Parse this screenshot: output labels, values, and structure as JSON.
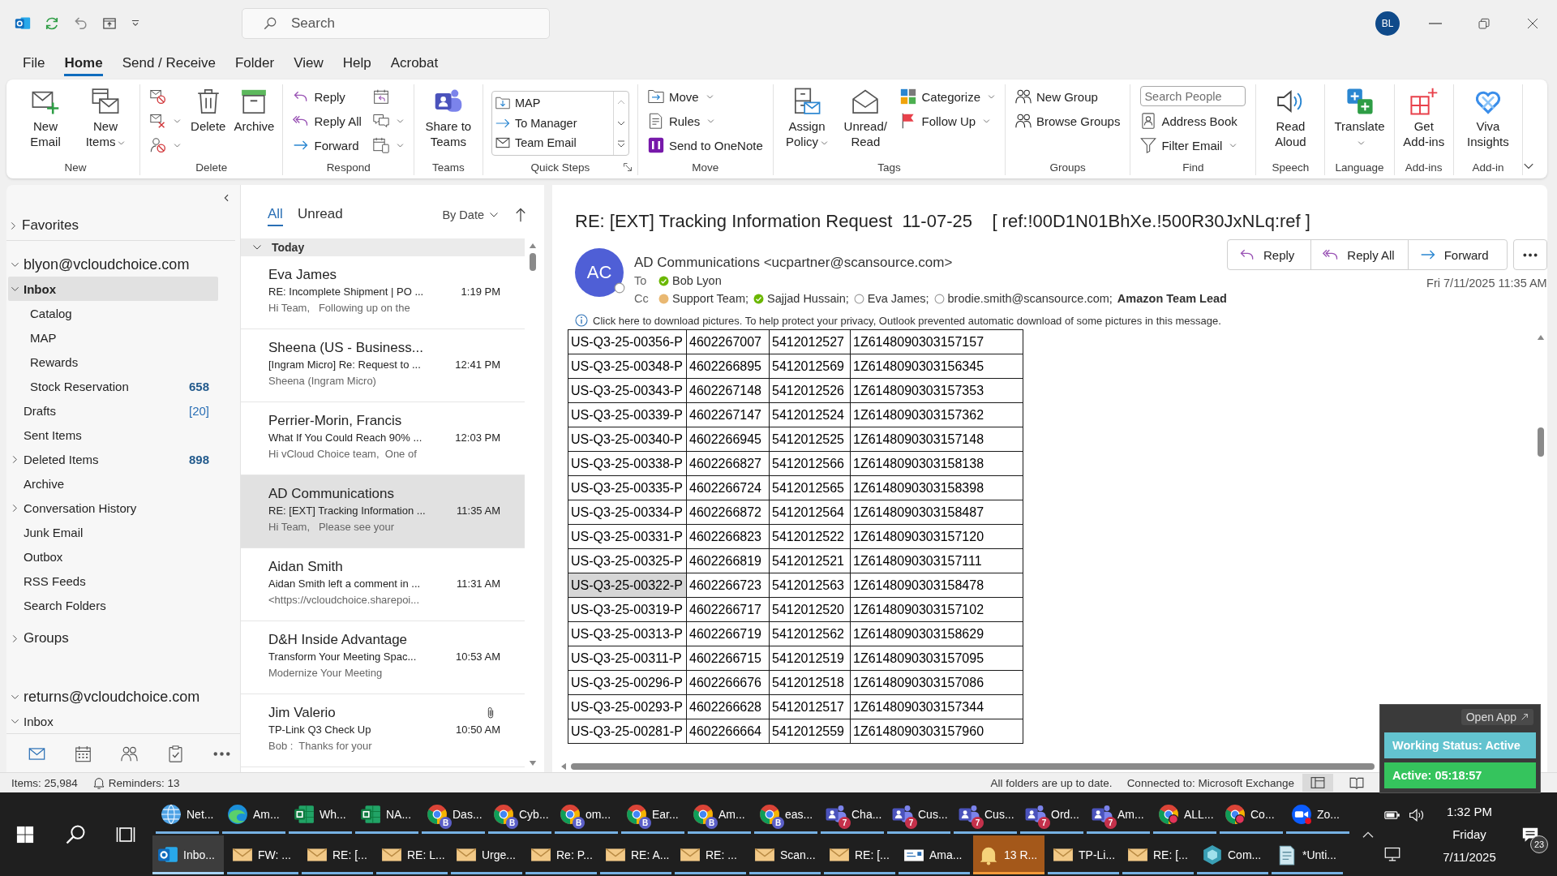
{
  "window": {
    "search_placeholder": "Search",
    "account_initials": "BL"
  },
  "menu_tabs": [
    {
      "label": "File",
      "selected": false
    },
    {
      "label": "Home",
      "selected": true
    },
    {
      "label": "Send / Receive",
      "selected": false
    },
    {
      "label": "Folder",
      "selected": false
    },
    {
      "label": "View",
      "selected": false
    },
    {
      "label": "Help",
      "selected": false
    },
    {
      "label": "Acrobat",
      "selected": false
    }
  ],
  "ribbon": {
    "groups": [
      {
        "label": "New",
        "items": [
          {
            "kind": "large",
            "label": "New Email",
            "dropdown": false
          },
          {
            "kind": "large",
            "label": "New Items",
            "dropdown": true
          }
        ]
      },
      {
        "label": "Delete",
        "items": [
          {
            "kind": "icon",
            "dropdown": false
          },
          {
            "kind": "icon",
            "dropdown": true
          },
          {
            "kind": "icon",
            "dropdown": true
          },
          {
            "kind": "large",
            "label": "Delete",
            "dropdown": false
          },
          {
            "kind": "large",
            "label": "Archive",
            "dropdown": false
          }
        ]
      },
      {
        "label": "Respond",
        "items": [
          {
            "kind": "small",
            "label": "Reply",
            "dropdown": false
          },
          {
            "kind": "small",
            "label": "Reply All",
            "dropdown": false
          },
          {
            "kind": "small",
            "label": "Forward",
            "dropdown": false
          },
          {
            "kind": "icon",
            "dropdown": false
          },
          {
            "kind": "icon",
            "dropdown": true
          },
          {
            "kind": "icon",
            "dropdown": true
          }
        ]
      },
      {
        "label": "Teams",
        "items": [
          {
            "kind": "large",
            "label": "Share to Teams",
            "dropdown": false
          }
        ]
      },
      {
        "label": "Quick Steps",
        "items": [
          {
            "kind": "quickstep",
            "label": "MAP",
            "dropdown": false
          },
          {
            "kind": "quickstep",
            "label": "To Manager",
            "dropdown": false
          },
          {
            "kind": "quickstep",
            "label": "Team Email",
            "dropdown": false
          }
        ]
      },
      {
        "label": "Move",
        "items": [
          {
            "kind": "small",
            "label": "Move",
            "dropdown": true
          },
          {
            "kind": "small",
            "label": "Rules",
            "dropdown": true
          },
          {
            "kind": "small",
            "label": "Send to OneNote",
            "dropdown": false
          }
        ]
      },
      {
        "label": "Tags",
        "items": [
          {
            "kind": "large",
            "label": "Assign Policy",
            "dropdown": true
          },
          {
            "kind": "large",
            "label": "Unread/ Read",
            "dropdown": false
          },
          {
            "kind": "small",
            "label": "Categorize",
            "dropdown": true
          },
          {
            "kind": "small",
            "label": "Follow Up",
            "dropdown": true
          }
        ]
      },
      {
        "label": "Groups",
        "items": [
          {
            "kind": "small",
            "label": "New Group",
            "dropdown": false
          },
          {
            "kind": "small",
            "label": "Browse Groups",
            "dropdown": false
          }
        ]
      },
      {
        "label": "Find",
        "items": [
          {
            "kind": "field",
            "placeholder": "Search People"
          },
          {
            "kind": "small",
            "label": "Address Book",
            "dropdown": false
          },
          {
            "kind": "small",
            "label": "Filter Email",
            "dropdown": true
          }
        ]
      },
      {
        "label": "Speech",
        "items": [
          {
            "kind": "large",
            "label": "Read Aloud",
            "dropdown": false
          }
        ]
      },
      {
        "label": "Language",
        "items": [
          {
            "kind": "large",
            "label": "Translate",
            "dropdown": true
          }
        ]
      },
      {
        "label": "Add-ins",
        "items": [
          {
            "kind": "large",
            "label": "Get Add-ins",
            "dropdown": false
          }
        ]
      },
      {
        "label": "Add-in",
        "items": [
          {
            "kind": "large",
            "label": "Viva Insights",
            "dropdown": false
          }
        ]
      }
    ]
  },
  "nav": {
    "sections": [
      {
        "kind": "header",
        "label": "Favorites",
        "expanded": false
      },
      {
        "kind": "account",
        "label": "blyon@vcloudchoice.com",
        "expanded": true,
        "children": [
          {
            "label": "Inbox",
            "expanded": true,
            "selected": true,
            "children": [
              {
                "label": "Catalog",
                "selected": false
              },
              {
                "label": "MAP",
                "selected": false
              },
              {
                "label": "Rewards",
                "selected": false
              },
              {
                "label": "Stock Reservation",
                "selected": false,
                "count": "658",
                "count_unread": true
              }
            ]
          },
          {
            "label": "Drafts",
            "selected": false,
            "count": "[20]",
            "count_unread": false
          },
          {
            "label": "Sent Items",
            "selected": false
          },
          {
            "label": "Deleted Items",
            "expanded": false,
            "selected": false,
            "count": "898",
            "count_unread": true
          },
          {
            "label": "Archive",
            "selected": false
          },
          {
            "label": "Conversation History",
            "expanded": false,
            "selected": false
          },
          {
            "label": "Junk Email",
            "selected": false
          },
          {
            "label": "Outbox",
            "selected": false
          },
          {
            "label": "RSS Feeds",
            "selected": false
          },
          {
            "label": "Search Folders",
            "selected": false
          }
        ]
      },
      {
        "kind": "header",
        "label": "Groups",
        "expanded": false
      },
      {
        "kind": "account",
        "label": "returns@vcloudchoice.com",
        "expanded": true,
        "children": [
          {
            "label": "Inbox",
            "expanded": true,
            "selected": false
          }
        ]
      }
    ],
    "modules": [
      {
        "selected": true
      },
      {
        "selected": false
      },
      {
        "selected": false
      },
      {
        "selected": false
      },
      {
        "selected": false
      }
    ]
  },
  "mail_list": {
    "filters": [
      {
        "label": "All",
        "selected": true
      },
      {
        "label": "Unread",
        "selected": false
      }
    ],
    "sort": "By Date",
    "groups": [
      {
        "label": "Today",
        "expanded": true,
        "messages": [
          {
            "sender": "Eva James",
            "subject": "RE: Incomplete Shipment | PO ...",
            "preview": "Hi Team,   Following up on the",
            "time": "1:19 PM",
            "selected": false,
            "attachment": false
          },
          {
            "sender": "Sheena (US - Business...",
            "subject": "[Ingram Micro] Re: Request to ...",
            "preview": "Sheena (Ingram Micro)",
            "time": "12:41 PM",
            "selected": false,
            "attachment": false
          },
          {
            "sender": "Perrier-Morin, Francis",
            "subject": "What If You Could Reach 90% ...",
            "preview": "Hi vCloud Choice team,  One of",
            "time": "12:03 PM",
            "selected": false,
            "attachment": false
          },
          {
            "sender": "AD Communications",
            "subject": "RE: [EXT] Tracking Information ...",
            "preview": "Hi Team,   Please see your",
            "time": "11:35 AM",
            "selected": true,
            "attachment": false
          },
          {
            "sender": "Aidan Smith",
            "subject": "Aidan Smith left a comment in ...",
            "preview": "<https://vcloudchoice.sharepoi...",
            "time": "11:31 AM",
            "selected": false,
            "attachment": false
          },
          {
            "sender": "D&H Inside Advantage",
            "subject": "Transform Your Meeting Spac...",
            "preview": "Modernize Your Meeting",
            "time": "10:53 AM",
            "selected": false,
            "attachment": false
          },
          {
            "sender": "Jim Valerio",
            "subject": "TP-Link Q3 Check Up",
            "preview": "Bob :  Thanks for your",
            "time": "10:50 AM",
            "selected": false,
            "attachment": true
          }
        ]
      }
    ]
  },
  "message": {
    "subject": "RE: [EXT] Tracking Information Request  11-07-25    [ ref:!00D1N01BhXe.!500R30JxNLq:ref ]",
    "sender": {
      "initials": "AC",
      "name": "AD Communications <ucpartner@scansource.com>",
      "kind": "offline"
    },
    "to_label": "To",
    "to": [
      {
        "name": "Bob Lyon",
        "kind": "available"
      }
    ],
    "cc_label": "Cc",
    "cc": [
      {
        "name": "Support Team;",
        "kind": "away"
      },
      {
        "name": "Sajjad Hussain;",
        "kind": "available"
      },
      {
        "name": "Eva James;",
        "kind": "offline"
      },
      {
        "name": "brodie.smith@scansource.com;",
        "kind": "offline"
      },
      {
        "name": "Amazon Team Lead",
        "kind": "group"
      }
    ],
    "actions": [
      {
        "label": "Reply"
      },
      {
        "label": "Reply All"
      },
      {
        "label": "Forward"
      }
    ],
    "date": "Fri 7/11/2025 11:35 AM",
    "info": "Click here to download pictures. To help protect your privacy, Outlook prevented automatic download of some pictures in this message.",
    "table": {
      "rows": [
        {
          "cells": [
            "US-Q3-25-00356-P",
            "4602267007",
            "5412012527",
            "1Z6148090303157157"
          ],
          "selected": false
        },
        {
          "cells": [
            "US-Q3-25-00348-P",
            "4602266895",
            "5412012569",
            "1Z6148090303156345"
          ],
          "selected": false
        },
        {
          "cells": [
            "US-Q3-25-00343-P",
            "4602267148",
            "5412012526",
            "1Z6148090303157353"
          ],
          "selected": false
        },
        {
          "cells": [
            "US-Q3-25-00339-P",
            "4602267147",
            "5412012524",
            "1Z6148090303157362"
          ],
          "selected": false
        },
        {
          "cells": [
            "US-Q3-25-00340-P",
            "4602266945",
            "5412012525",
            "1Z6148090303157148"
          ],
          "selected": false
        },
        {
          "cells": [
            "US-Q3-25-00338-P",
            "4602266827",
            "5412012566",
            "1Z6148090303158138"
          ],
          "selected": false
        },
        {
          "cells": [
            "US-Q3-25-00335-P",
            "4602266724",
            "5412012565",
            "1Z6148090303158398"
          ],
          "selected": false
        },
        {
          "cells": [
            "US-Q3-25-00334-P",
            "4602266872",
            "5412012564",
            "1Z6148090303158487"
          ],
          "selected": false
        },
        {
          "cells": [
            "US-Q3-25-00331-P",
            "4602266823",
            "5412012522",
            "1Z6148090303157120"
          ],
          "selected": false
        },
        {
          "cells": [
            "US-Q3-25-00325-P",
            "4602266819",
            "5412012521",
            "1Z6148090303157111"
          ],
          "selected": false
        },
        {
          "cells": [
            "US-Q3-25-00322-P",
            "4602266723",
            "5412012563",
            "1Z6148090303158478"
          ],
          "selected": true
        },
        {
          "cells": [
            "US-Q3-25-00319-P",
            "4602266717",
            "5412012520",
            "1Z6148090303157102"
          ],
          "selected": false
        },
        {
          "cells": [
            "US-Q3-25-00313-P",
            "4602266719",
            "5412012562",
            "1Z6148090303158629"
          ],
          "selected": false
        },
        {
          "cells": [
            "US-Q3-25-00311-P",
            "4602266715",
            "5412012519",
            "1Z6148090303157095"
          ],
          "selected": false
        },
        {
          "cells": [
            "US-Q3-25-00296-P",
            "4602266676",
            "5412012518",
            "1Z6148090303157086"
          ],
          "selected": false
        },
        {
          "cells": [
            "US-Q3-25-00293-P",
            "4602266628",
            "5412012517",
            "1Z6148090303157344"
          ],
          "selected": false
        },
        {
          "cells": [
            "US-Q3-25-00281-P",
            "4602266664",
            "5412012559",
            "1Z6148090303157960"
          ],
          "selected": false
        }
      ]
    }
  },
  "status_bar": {
    "items": "Items: 25,984",
    "reminders": "Reminders: 13",
    "sync": "All folders are up to date.",
    "connection": "Connected to: Microsoft Exchange",
    "views": [
      {
        "selected": true
      },
      {
        "selected": false
      }
    ]
  },
  "status_widget": {
    "open_app": "Open App",
    "working_status": "Working Status: Active",
    "timer": "Active: 05:18:57"
  },
  "taskbar": {
    "rows": [
      {
        "items": [
          {
            "label": "Net...",
            "kind": "network",
            "selected": false,
            "alert": false
          },
          {
            "label": "Am...",
            "kind": "edge",
            "selected": false,
            "alert": false
          },
          {
            "label": "Wh...",
            "kind": "excel",
            "selected": false,
            "alert": false
          },
          {
            "label": "NA...",
            "kind": "excel",
            "selected": false,
            "alert": false
          },
          {
            "label": "Das...",
            "kind": "chrome",
            "badge": "B",
            "selected": false,
            "alert": false
          },
          {
            "label": "Cyb...",
            "kind": "chrome",
            "badge": "B",
            "selected": false,
            "alert": false
          },
          {
            "label": "om...",
            "kind": "chrome",
            "badge": "B",
            "selected": false,
            "alert": false
          },
          {
            "label": "Ear...",
            "kind": "chrome",
            "badge": "B",
            "selected": false,
            "alert": false
          },
          {
            "label": "Am...",
            "kind": "chrome",
            "badge": "B",
            "selected": false,
            "alert": false
          },
          {
            "label": "eas...",
            "kind": "chrome",
            "badge": "B",
            "selected": false,
            "alert": false
          },
          {
            "label": "Cha...",
            "kind": "teams",
            "badge": "7",
            "selected": false,
            "alert": false
          },
          {
            "label": "Cus...",
            "kind": "teams",
            "badge": "7",
            "selected": false,
            "alert": false
          },
          {
            "label": "Cus...",
            "kind": "teams",
            "badge": "7",
            "selected": false,
            "alert": false
          },
          {
            "label": "Ord...",
            "kind": "teams",
            "badge": "7",
            "selected": false,
            "alert": false
          },
          {
            "label": "Am...",
            "kind": "teams",
            "badge": "7",
            "selected": false,
            "alert": false
          },
          {
            "label": "ALL...",
            "kind": "chrome-alert",
            "selected": false,
            "alert": false
          },
          {
            "label": "Co...",
            "kind": "chrome-alert",
            "selected": false,
            "alert": false
          },
          {
            "label": "Zo...",
            "kind": "zoom",
            "selected": false,
            "alert": false
          }
        ]
      },
      {
        "items": [
          {
            "label": "Inbo...",
            "kind": "outlook",
            "selected": true,
            "alert": false
          },
          {
            "label": "FW: ...",
            "kind": "mail",
            "selected": false,
            "alert": false
          },
          {
            "label": "RE: [...",
            "kind": "mail",
            "selected": false,
            "alert": false
          },
          {
            "label": "RE: L...",
            "kind": "mail",
            "selected": false,
            "alert": false
          },
          {
            "label": "Urge...",
            "kind": "mail",
            "selected": false,
            "alert": false
          },
          {
            "label": "Re: P...",
            "kind": "mail",
            "selected": false,
            "alert": false
          },
          {
            "label": "RE: A...",
            "kind": "mail",
            "selected": false,
            "alert": false
          },
          {
            "label": "RE: ...",
            "kind": "mail",
            "selected": false,
            "alert": false
          },
          {
            "label": "Scan...",
            "kind": "mail",
            "selected": false,
            "alert": false
          },
          {
            "label": "RE: [...",
            "kind": "mail",
            "selected": false,
            "alert": false
          },
          {
            "label": "Ama...",
            "kind": "letter",
            "selected": false,
            "alert": false
          },
          {
            "label": "13 R...",
            "kind": "reminder",
            "selected": false,
            "alert": true
          },
          {
            "label": "TP-Li...",
            "kind": "mail",
            "selected": false,
            "alert": false
          },
          {
            "label": "RE: [...",
            "kind": "mail",
            "selected": false,
            "alert": false
          },
          {
            "label": "Com...",
            "kind": "hexagon",
            "selected": false,
            "alert": false
          },
          {
            "label": "*Unti...",
            "kind": "notepad",
            "selected": false,
            "alert": false
          }
        ]
      }
    ]
  },
  "tray": {
    "time": "1:32 PM",
    "day": "Friday",
    "date": "7/11/2025",
    "notifications": "23"
  }
}
